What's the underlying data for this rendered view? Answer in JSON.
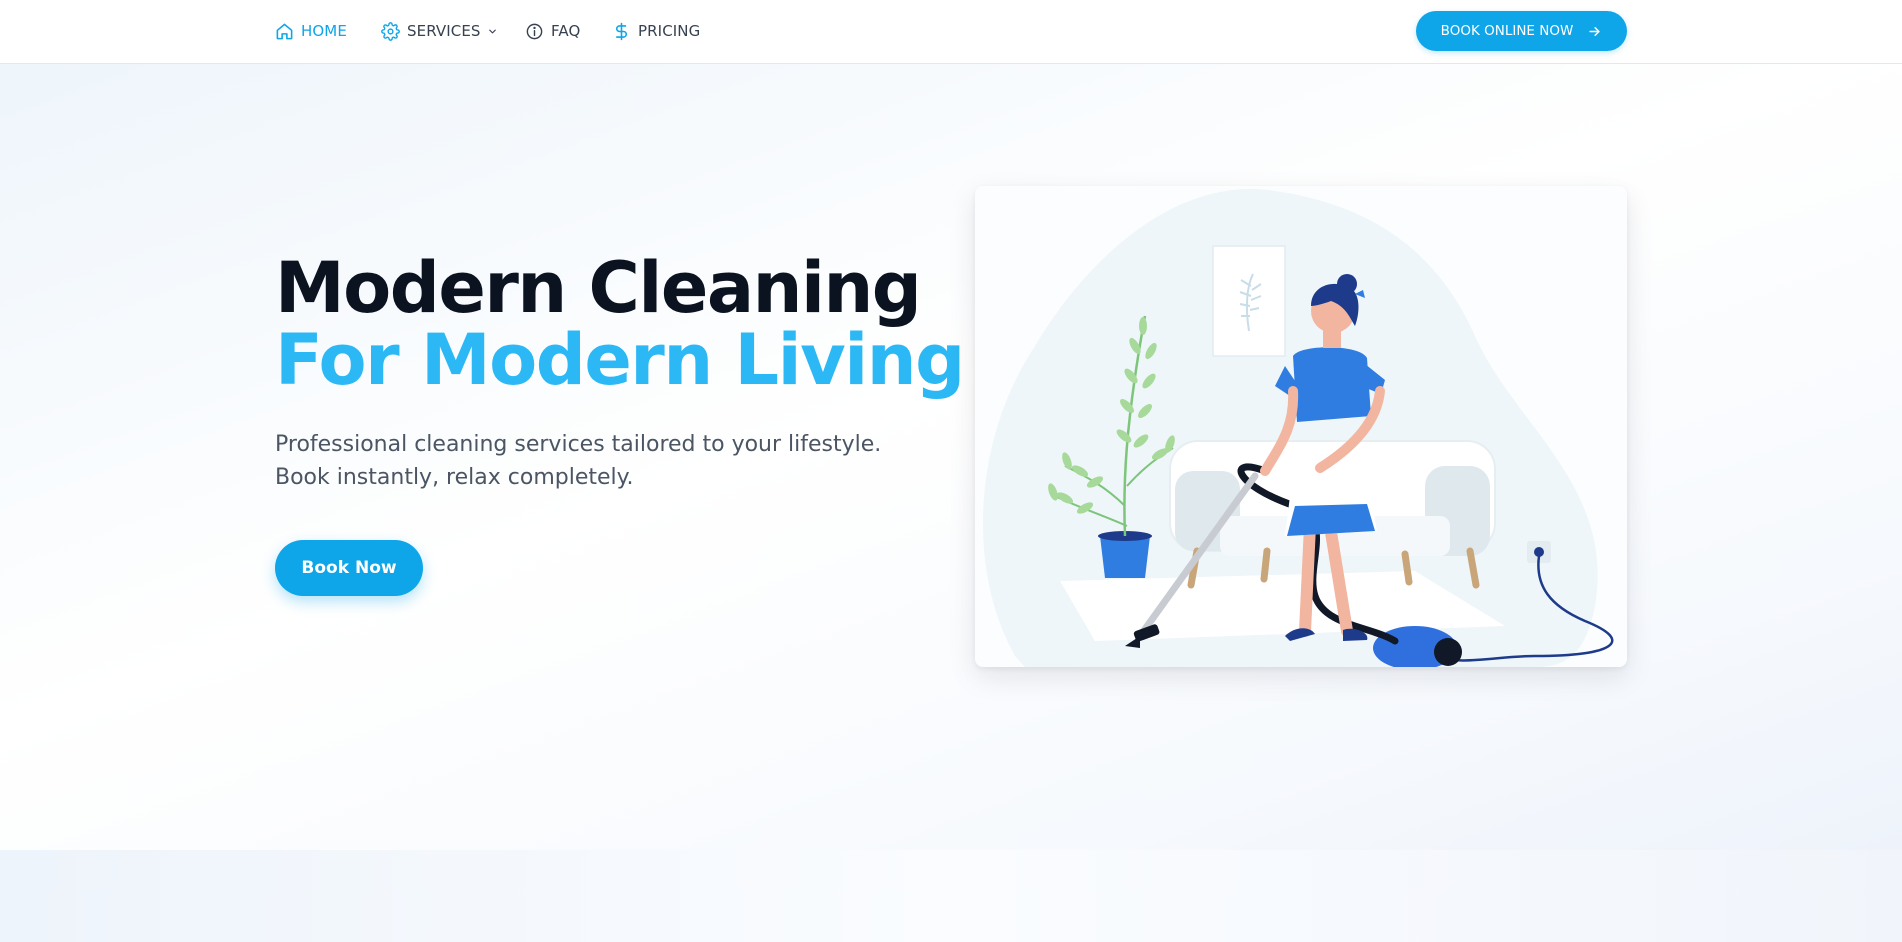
{
  "nav": {
    "items": [
      {
        "label": "HOME",
        "icon": "home-icon",
        "active": true
      },
      {
        "label": "SERVICES",
        "icon": "gear-icon",
        "has_dropdown": true
      },
      {
        "label": "FAQ",
        "icon": "info-icon"
      },
      {
        "label": "PRICING",
        "icon": "dollar-icon"
      }
    ],
    "cta_label": "BOOK ONLINE NOW",
    "cta_icon": "arrow-right-icon"
  },
  "hero": {
    "headline_line1": "Modern Cleaning",
    "headline_line2": "For Modern Living",
    "subtitle": "Professional cleaning services tailored to your lifestyle. Book instantly, relax completely.",
    "button_label": "Book Now",
    "illustration": "woman-vacuuming-illustration"
  },
  "colors": {
    "accent": "#0ea5e9",
    "headline_accent": "#2cb8f5",
    "headline": "#0b1220",
    "text_muted": "#4b5563"
  }
}
